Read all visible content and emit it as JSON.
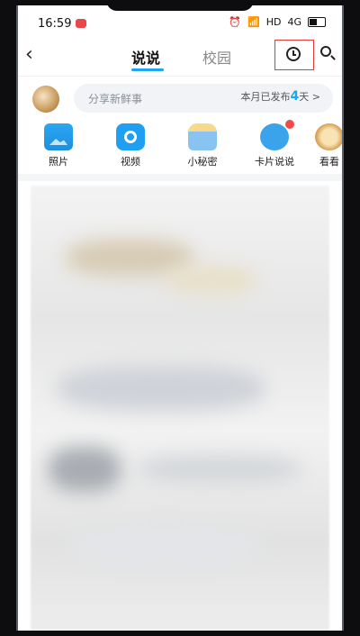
{
  "status_bar": {
    "time": "16:59",
    "network": "HD",
    "signal": "4G"
  },
  "nav": {
    "tabs": [
      {
        "label": "说说",
        "active": true
      },
      {
        "label": "校园",
        "active": false
      }
    ],
    "icons": [
      "back-arrow-icon",
      "clock-icon",
      "search-icon"
    ]
  },
  "compose": {
    "placeholder": "分享新鲜事",
    "stat_prefix": "本月已发布",
    "stat_count": "4",
    "stat_suffix": "天 >"
  },
  "shortcuts": [
    {
      "label": "照片",
      "icon": "photo-icon"
    },
    {
      "label": "视频",
      "icon": "camera-icon"
    },
    {
      "label": "小秘密",
      "icon": "secret-jar-icon"
    },
    {
      "label": "卡片说说",
      "icon": "card-mascot-icon"
    },
    {
      "label": "看看",
      "icon": "more-icon"
    }
  ],
  "colors": {
    "accent": "#1ea7ee",
    "highlight_box": "#e53935"
  }
}
